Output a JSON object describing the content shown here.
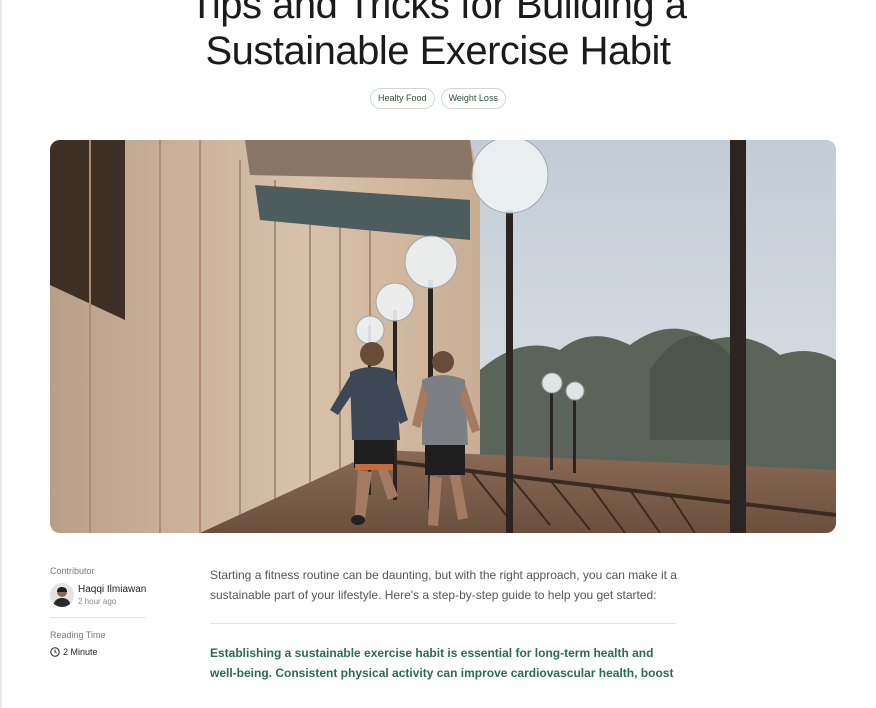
{
  "article": {
    "title_line1": "Tips and Tricks for Building a",
    "title_line2": "Sustainable Exercise Habit",
    "tags": [
      "Healty Food",
      "Weight Loss"
    ]
  },
  "meta": {
    "contributor_label": "Contributor",
    "author_name": "Haqqi Ilmiawan",
    "author_time": "2 hour ago",
    "reading_time_label": "Reading Time",
    "reading_time_value": "2 Minute"
  },
  "body": {
    "intro": "Starting a fitness routine can be daunting, but with the right approach, you can make it a sustainable part of your lifestyle. Here's a step-by-step guide to help you get started:",
    "highlight": "Establishing a sustainable exercise habit is essential for long-term health and well-being. Consistent physical activity can improve cardiovascular health, boost"
  },
  "colors": {
    "accent_green": "#2d6a4f"
  }
}
